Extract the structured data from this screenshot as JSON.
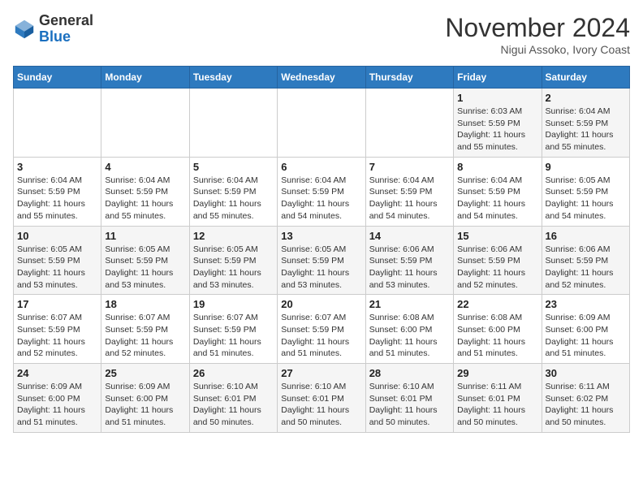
{
  "header": {
    "logo_general": "General",
    "logo_blue": "Blue",
    "month_title": "November 2024",
    "location": "Nigui Assoko, Ivory Coast"
  },
  "calendar": {
    "days_of_week": [
      "Sunday",
      "Monday",
      "Tuesday",
      "Wednesday",
      "Thursday",
      "Friday",
      "Saturday"
    ],
    "weeks": [
      [
        {
          "day": "",
          "info": ""
        },
        {
          "day": "",
          "info": ""
        },
        {
          "day": "",
          "info": ""
        },
        {
          "day": "",
          "info": ""
        },
        {
          "day": "",
          "info": ""
        },
        {
          "day": "1",
          "info": "Sunrise: 6:03 AM\nSunset: 5:59 PM\nDaylight: 11 hours and 55 minutes."
        },
        {
          "day": "2",
          "info": "Sunrise: 6:04 AM\nSunset: 5:59 PM\nDaylight: 11 hours and 55 minutes."
        }
      ],
      [
        {
          "day": "3",
          "info": "Sunrise: 6:04 AM\nSunset: 5:59 PM\nDaylight: 11 hours and 55 minutes."
        },
        {
          "day": "4",
          "info": "Sunrise: 6:04 AM\nSunset: 5:59 PM\nDaylight: 11 hours and 55 minutes."
        },
        {
          "day": "5",
          "info": "Sunrise: 6:04 AM\nSunset: 5:59 PM\nDaylight: 11 hours and 55 minutes."
        },
        {
          "day": "6",
          "info": "Sunrise: 6:04 AM\nSunset: 5:59 PM\nDaylight: 11 hours and 54 minutes."
        },
        {
          "day": "7",
          "info": "Sunrise: 6:04 AM\nSunset: 5:59 PM\nDaylight: 11 hours and 54 minutes."
        },
        {
          "day": "8",
          "info": "Sunrise: 6:04 AM\nSunset: 5:59 PM\nDaylight: 11 hours and 54 minutes."
        },
        {
          "day": "9",
          "info": "Sunrise: 6:05 AM\nSunset: 5:59 PM\nDaylight: 11 hours and 54 minutes."
        }
      ],
      [
        {
          "day": "10",
          "info": "Sunrise: 6:05 AM\nSunset: 5:59 PM\nDaylight: 11 hours and 53 minutes."
        },
        {
          "day": "11",
          "info": "Sunrise: 6:05 AM\nSunset: 5:59 PM\nDaylight: 11 hours and 53 minutes."
        },
        {
          "day": "12",
          "info": "Sunrise: 6:05 AM\nSunset: 5:59 PM\nDaylight: 11 hours and 53 minutes."
        },
        {
          "day": "13",
          "info": "Sunrise: 6:05 AM\nSunset: 5:59 PM\nDaylight: 11 hours and 53 minutes."
        },
        {
          "day": "14",
          "info": "Sunrise: 6:06 AM\nSunset: 5:59 PM\nDaylight: 11 hours and 53 minutes."
        },
        {
          "day": "15",
          "info": "Sunrise: 6:06 AM\nSunset: 5:59 PM\nDaylight: 11 hours and 52 minutes."
        },
        {
          "day": "16",
          "info": "Sunrise: 6:06 AM\nSunset: 5:59 PM\nDaylight: 11 hours and 52 minutes."
        }
      ],
      [
        {
          "day": "17",
          "info": "Sunrise: 6:07 AM\nSunset: 5:59 PM\nDaylight: 11 hours and 52 minutes."
        },
        {
          "day": "18",
          "info": "Sunrise: 6:07 AM\nSunset: 5:59 PM\nDaylight: 11 hours and 52 minutes."
        },
        {
          "day": "19",
          "info": "Sunrise: 6:07 AM\nSunset: 5:59 PM\nDaylight: 11 hours and 51 minutes."
        },
        {
          "day": "20",
          "info": "Sunrise: 6:07 AM\nSunset: 5:59 PM\nDaylight: 11 hours and 51 minutes."
        },
        {
          "day": "21",
          "info": "Sunrise: 6:08 AM\nSunset: 6:00 PM\nDaylight: 11 hours and 51 minutes."
        },
        {
          "day": "22",
          "info": "Sunrise: 6:08 AM\nSunset: 6:00 PM\nDaylight: 11 hours and 51 minutes."
        },
        {
          "day": "23",
          "info": "Sunrise: 6:09 AM\nSunset: 6:00 PM\nDaylight: 11 hours and 51 minutes."
        }
      ],
      [
        {
          "day": "24",
          "info": "Sunrise: 6:09 AM\nSunset: 6:00 PM\nDaylight: 11 hours and 51 minutes."
        },
        {
          "day": "25",
          "info": "Sunrise: 6:09 AM\nSunset: 6:00 PM\nDaylight: 11 hours and 51 minutes."
        },
        {
          "day": "26",
          "info": "Sunrise: 6:10 AM\nSunset: 6:01 PM\nDaylight: 11 hours and 50 minutes."
        },
        {
          "day": "27",
          "info": "Sunrise: 6:10 AM\nSunset: 6:01 PM\nDaylight: 11 hours and 50 minutes."
        },
        {
          "day": "28",
          "info": "Sunrise: 6:10 AM\nSunset: 6:01 PM\nDaylight: 11 hours and 50 minutes."
        },
        {
          "day": "29",
          "info": "Sunrise: 6:11 AM\nSunset: 6:01 PM\nDaylight: 11 hours and 50 minutes."
        },
        {
          "day": "30",
          "info": "Sunrise: 6:11 AM\nSunset: 6:02 PM\nDaylight: 11 hours and 50 minutes."
        }
      ]
    ]
  }
}
